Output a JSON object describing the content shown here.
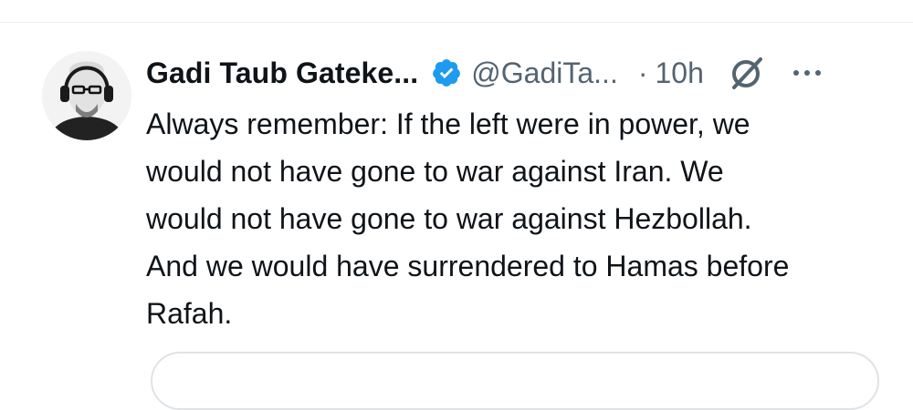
{
  "tweet": {
    "author_name": "Gadi Taub Gateke...",
    "handle": "@GadiTa...",
    "separator": "·",
    "time": "10h",
    "text_lines": [
      "Always remember: If the left were in power, we",
      "would not have gone to war against Iran. We",
      "would not have gone to war against Hezbollah.",
      "And we would have surrendered to Hamas before",
      "Rafah."
    ]
  },
  "icons": {
    "verified": "verified-badge-icon",
    "grok": "grok-icon",
    "more": "more-options-icon"
  },
  "colors": {
    "text": "#0f1419",
    "secondary": "#536471",
    "verified": "#1d9bf0",
    "divider": "#eceff1"
  }
}
